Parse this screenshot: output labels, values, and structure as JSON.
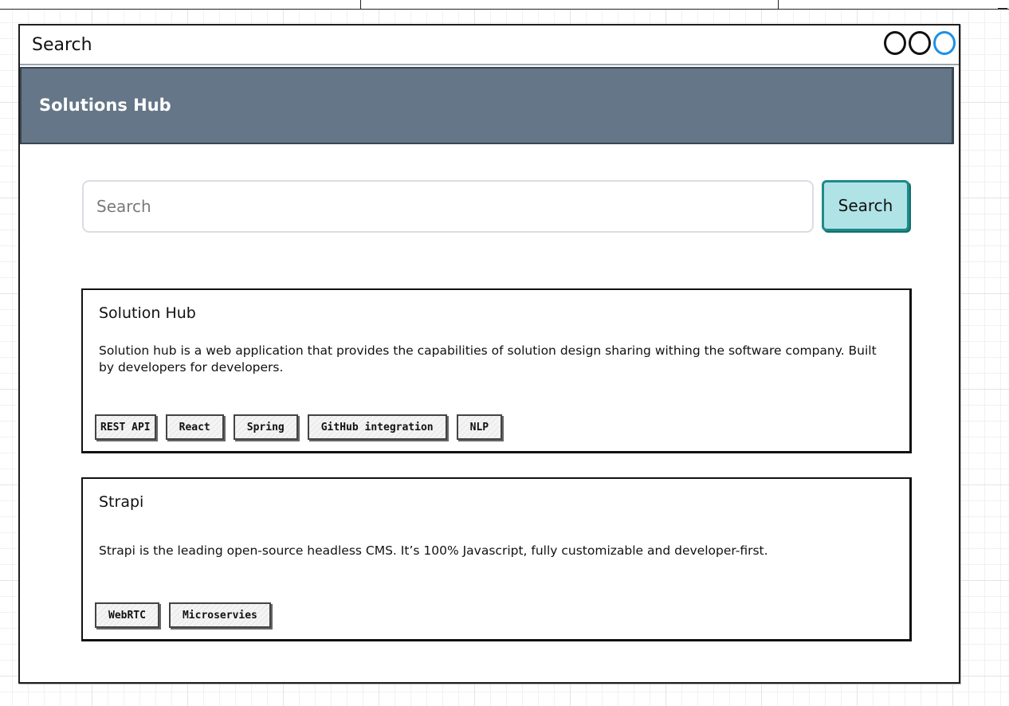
{
  "window": {
    "title": "Search"
  },
  "app": {
    "title": "Solutions Hub"
  },
  "search": {
    "placeholder": "Search",
    "value": "",
    "button_label": "Search"
  },
  "results": [
    {
      "title": "Solution Hub",
      "description": "Solution hub is a web application that provides the capabilities of solution design sharing withing the software company. Built by developers for developers.",
      "tags": [
        "REST API",
        "React",
        "Spring",
        "GitHub integration",
        "NLP"
      ]
    },
    {
      "title": "Strapi",
      "description": "Strapi is the leading open-source headless CMS. It’s 100% Javascript, fully customizable and developer-first.",
      "tags": [
        "WebRTC",
        "Microservies"
      ]
    }
  ],
  "colors": {
    "header_bg": "#647687",
    "button_bg": "#b0e3e6",
    "button_border": "#1f8a8a",
    "active_control": "#1e8fe6"
  }
}
